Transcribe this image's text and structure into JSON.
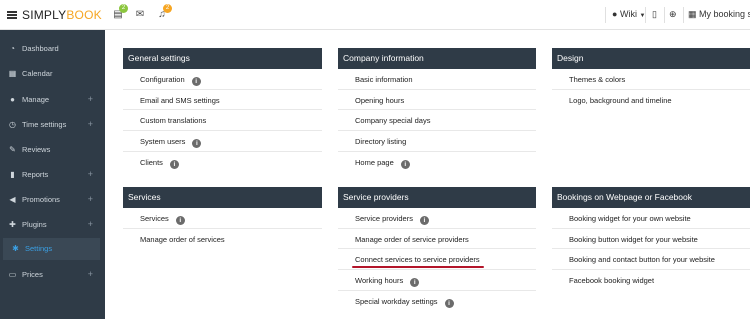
{
  "topbar": {
    "logo_part1": "SIMPLY",
    "logo_part2": "BOOK",
    "badges": {
      "dashboard": "2",
      "notifications": "2"
    },
    "wiki_label": "Wiki",
    "bookings_label": "My booking s"
  },
  "colors": {
    "sidebar_bg": "#2f3b47",
    "panel_head_bg": "#2f3b47",
    "accent_blue": "#3aa0e4",
    "logo_accent": "#f6a623",
    "badge_green": "#8cc63f",
    "badge_orange": "#f6a623",
    "underline_red": "#b3152a"
  },
  "sidebar": {
    "items": [
      {
        "label": "Dashboard",
        "icon": "dashboard-icon",
        "glyph": "◔",
        "plus": ""
      },
      {
        "label": "Calendar",
        "icon": "calendar-icon",
        "glyph": "▦",
        "plus": ""
      },
      {
        "label": "Manage",
        "icon": "user-icon",
        "glyph": "●",
        "plus": "+"
      },
      {
        "label": "Time settings",
        "icon": "clock-icon",
        "glyph": "◷",
        "plus": "+"
      },
      {
        "label": "Reviews",
        "icon": "comments-icon",
        "glyph": "✎",
        "plus": ""
      },
      {
        "label": "Reports",
        "icon": "chart-icon",
        "glyph": "▮",
        "plus": "+"
      },
      {
        "label": "Promotions",
        "icon": "megaphone-icon",
        "glyph": "◀",
        "plus": "+"
      },
      {
        "label": "Plugins",
        "icon": "plug-icon",
        "glyph": "✚",
        "plus": "+"
      },
      {
        "label": "Settings",
        "icon": "settings-icon",
        "glyph": "✱",
        "plus": ""
      },
      {
        "label": "Prices",
        "icon": "price-icon",
        "glyph": "▭",
        "plus": "+"
      }
    ]
  },
  "panels": {
    "general": {
      "title": "General settings",
      "links": [
        {
          "label": "Configuration",
          "info": "i"
        },
        {
          "label": "Email and SMS settings",
          "info": ""
        },
        {
          "label": "Custom translations",
          "info": ""
        },
        {
          "label": "System users",
          "info": "i"
        },
        {
          "label": "Clients",
          "info": "i"
        }
      ]
    },
    "company": {
      "title": "Company information",
      "links": [
        {
          "label": "Basic information",
          "info": ""
        },
        {
          "label": "Opening hours",
          "info": ""
        },
        {
          "label": "Company special days",
          "info": ""
        },
        {
          "label": "Directory listing",
          "info": ""
        },
        {
          "label": "Home page",
          "info": "i"
        }
      ]
    },
    "design": {
      "title": "Design",
      "links": [
        {
          "label": "Themes & colors",
          "info": ""
        },
        {
          "label": "Logo, background and timeline",
          "info": ""
        }
      ]
    },
    "services": {
      "title": "Services",
      "links": [
        {
          "label": "Services",
          "info": "i"
        },
        {
          "label": "Manage order of services",
          "info": ""
        }
      ]
    },
    "providers": {
      "title": "Service providers",
      "links": [
        {
          "label": "Service providers",
          "info": "i"
        },
        {
          "label": "Manage order of service providers",
          "info": ""
        },
        {
          "label": "Connect services to service providers",
          "info": ""
        },
        {
          "label": "Working hours",
          "info": "i"
        },
        {
          "label": "Special workday settings",
          "info": "i"
        }
      ]
    },
    "bookings": {
      "title": "Bookings on Webpage or Facebook",
      "links": [
        {
          "label": "Booking widget for your own website",
          "info": ""
        },
        {
          "label": "Booking button widget for your website",
          "info": ""
        },
        {
          "label": "Booking and contact button for your website",
          "info": ""
        },
        {
          "label": "Facebook booking widget",
          "info": ""
        }
      ]
    }
  }
}
